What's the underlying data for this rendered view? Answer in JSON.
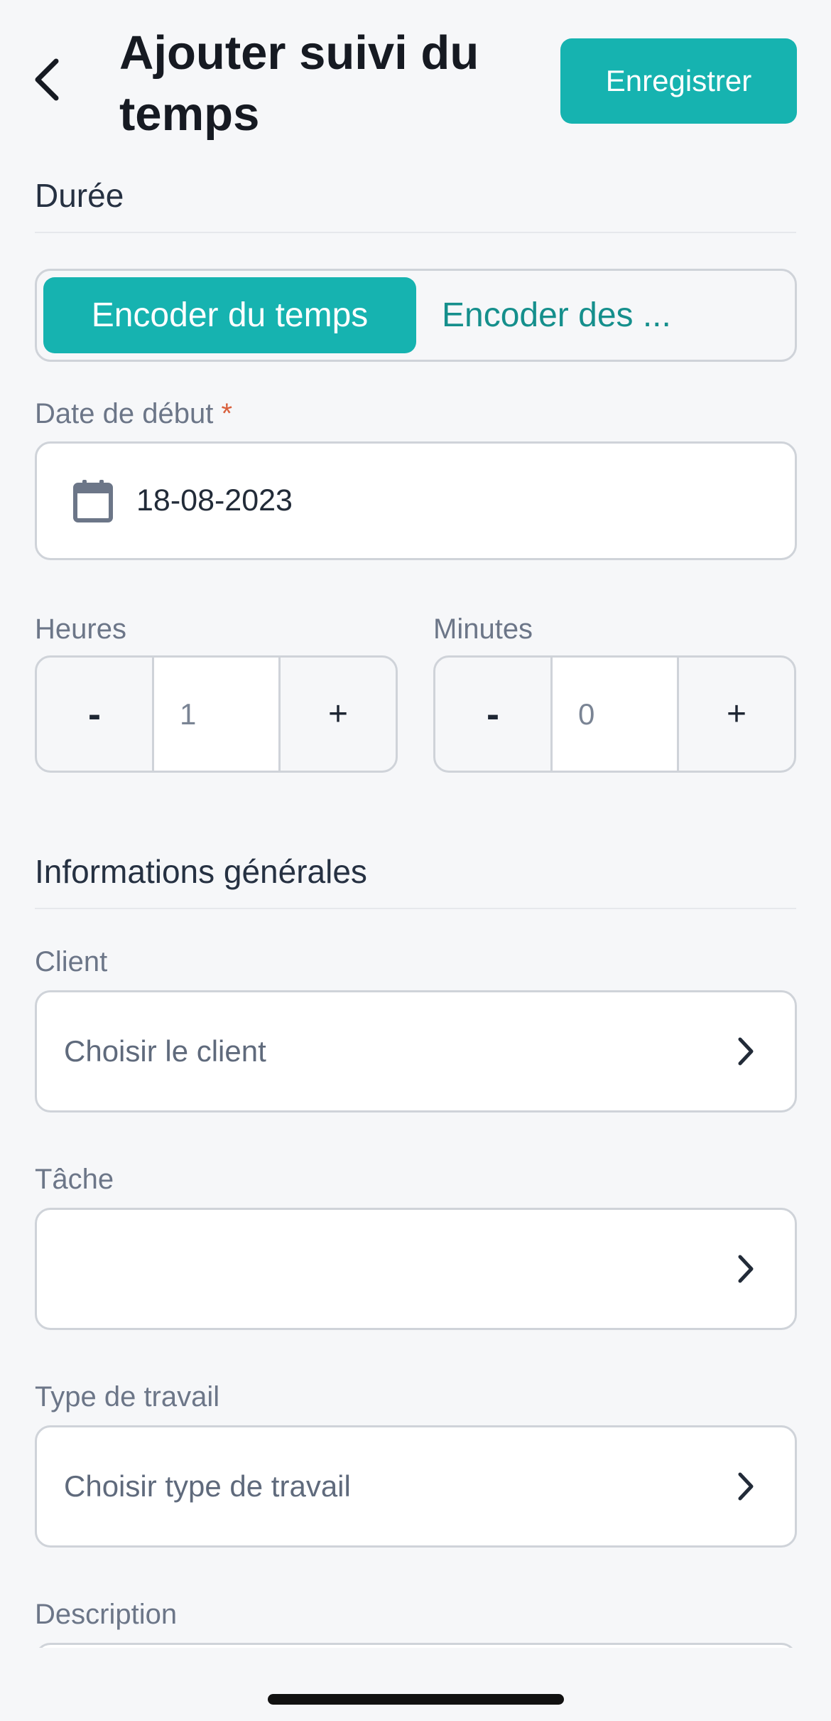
{
  "header": {
    "back_icon": "chevron-left-icon",
    "title_line1": "Ajouter suivi du",
    "title_line2": "temps",
    "save_label": "Enregistrer"
  },
  "duration": {
    "section_title": "Durée",
    "segments": [
      "Encoder du temps",
      "Encoder des ..."
    ],
    "selected_segment": "Encoder du temps",
    "start_date_label": "Date de début",
    "required_mark": "*",
    "start_date_value": "18-08-2023",
    "date_icon": "calendar-icon",
    "hours": {
      "label": "Heures",
      "minus": "-",
      "value": "1",
      "plus": "+"
    },
    "minutes": {
      "label": "Minutes",
      "minus": "-",
      "value": "0",
      "plus": "+"
    }
  },
  "general": {
    "section_title": "Informations générales",
    "client": {
      "label": "Client",
      "placeholder": "Choisir le client"
    },
    "task": {
      "label": "Tâche",
      "placeholder": ""
    },
    "work_type": {
      "label": "Type de travail",
      "placeholder": "Choisir type de travail"
    },
    "description": {
      "label": "Description"
    }
  },
  "colors": {
    "accent": "#16b3b0",
    "accent_text": "#158f8c",
    "required": "#d9603d",
    "background": "#f6f7f9"
  }
}
